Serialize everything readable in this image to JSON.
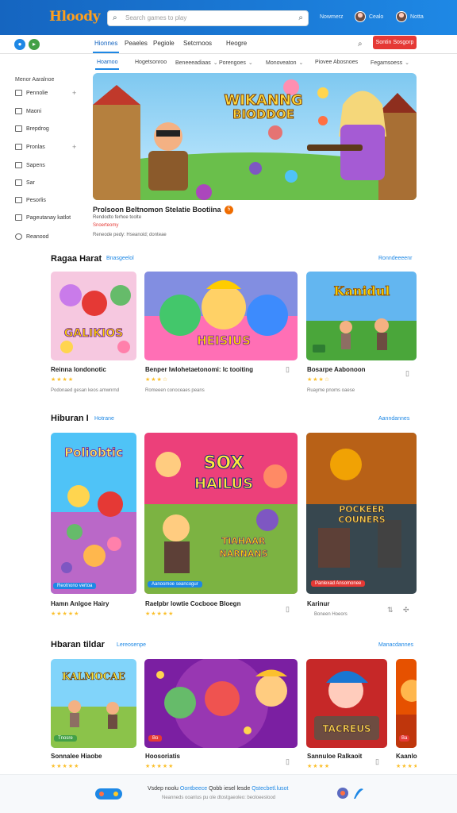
{
  "header": {
    "logo": "Hloody",
    "search_placeholder": "Search games to play",
    "links": [
      "Nowmerz",
      "Cealo",
      "Notta"
    ],
    "colors": {
      "bar": "#1565c0",
      "accent": "#ff9f1c"
    }
  },
  "nav": {
    "tabs": [
      "Hionnes",
      "Peaeles",
      "Pegiole",
      "Setcrnoos",
      "Heogre"
    ],
    "signup": "Sontin Sosgorp"
  },
  "subnav": {
    "tabs": [
      "Hoamoo",
      "Hogetsonroo",
      "Beneeeadiaas",
      "Porengoes",
      "Monoveaton",
      "Piovee Abosnoes",
      "Fegamsoess"
    ]
  },
  "sidebar": {
    "title": "Menor Aaralnoe",
    "items": [
      "Pennolie",
      "Maoni",
      "Brepdrog",
      "Pronlas",
      "Sapens",
      "Sar",
      "Pesorlis",
      "Pageutanay katlot",
      "Reanood"
    ]
  },
  "hero": {
    "art_text": "WIKANNG BIODDOE",
    "title": "Prolsoon Beltnomon Stelatie Bootiina",
    "badge": "5",
    "meta1": "Rendodto ferhoe toolte",
    "meta2": "Snoerteomy",
    "meta3": "Reneode pedy: Hseanoid; donteae"
  },
  "sections": [
    {
      "title": "Ragaa Harat",
      "subtitle": "Bnasgeelol",
      "link": "Ronndeeeenr",
      "cards": [
        {
          "art": "GALIKIOS",
          "title": "Reinna londonotic",
          "stars": "★★★★",
          "meta": "Podonaed gesan keos amwnrnd"
        },
        {
          "art": "HEISIUS",
          "title": "Benper lwlohetaetonomi: lc tooiting",
          "stars": "★★★☆",
          "meta": "Romeeen conoceaes peans"
        },
        {
          "art": "Kanidul",
          "title": "Bosarpe Aabonoon",
          "stars": "★★★☆",
          "meta": "Ruayme pnoms oaese"
        }
      ]
    },
    {
      "title": "Hiburan I",
      "subtitle": "Hotrane",
      "link": "Aanndannes",
      "cards": [
        {
          "art": "Poliobtic",
          "tag": "Reotnono vertoa",
          "title": "Hamn Anlgoe Hairy",
          "stars": "★★★★★",
          "meta": ""
        },
        {
          "art": "SOX HAILUS",
          "art2": "TIAHAAR NARNANS",
          "tag": "Aanoomoe seancogur",
          "title": "Raelpbr lowtie Cocbooe Bloegn",
          "stars": "★★★★★",
          "meta": ""
        },
        {
          "art": "POCKEER COUNERS",
          "tag": "Panlexad Ansomonee",
          "title": "Karinur",
          "stars": "★★★★★",
          "meta": "Boneen Hoeors"
        }
      ]
    },
    {
      "title": "Hbaran tildar",
      "subtitle": "Lereosenpe",
      "link": "Manacdannes",
      "cards": [
        {
          "art": "KALMOCAE",
          "tag": "Tnosre",
          "title": "Sonnalee Hiaobe",
          "stars": "★★★★★",
          "meta": ""
        },
        {
          "art": "",
          "tag": "Bo",
          "title": "Hoosoriatis",
          "stars": "★★★★★",
          "meta": ""
        },
        {
          "art": "TACREUS",
          "tag": "",
          "title": "Sannuloe Ralkaoit",
          "stars": "★★★★",
          "meta": ""
        },
        {
          "art": "",
          "tag": "Ba",
          "title": "Kaanlo",
          "stars": "★★★★",
          "meta": ""
        }
      ]
    }
  ],
  "footer": {
    "text_a": "Vsdep noolu",
    "text_b": "Oontbeece",
    "text_c": "Qobb iesel lesde",
    "text_d": "Qstecbetl.lusot",
    "sub": "Neanneds ooanlus pu ole dtostgaeoleo: beoloeeslood"
  }
}
